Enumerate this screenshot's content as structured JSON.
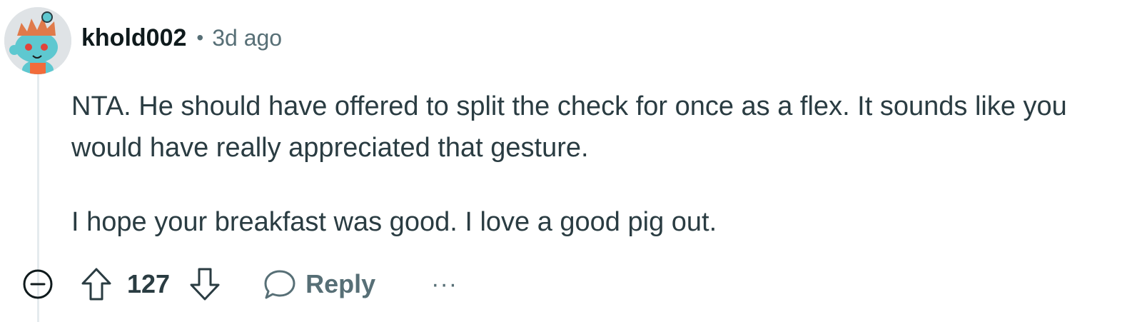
{
  "comment": {
    "username": "khold002",
    "separator": "•",
    "timestamp": "3d ago",
    "paragraphs": [
      "NTA. He should have offered to split the check for once as a flex. It sounds like you would have really appreciated that gesture.",
      "I hope your breakfast was good. I love a good pig out."
    ]
  },
  "actions": {
    "score": "127",
    "reply_label": "Reply",
    "more_label": "···"
  },
  "icons": {
    "avatar": "snoo-avatar-icon",
    "collapse": "collapse-minus-icon",
    "upvote": "upvote-arrow-icon",
    "downvote": "downvote-arrow-icon",
    "reply": "speech-bubble-icon",
    "more": "ellipsis-icon"
  },
  "colors": {
    "meta_gray": "#576f76",
    "body_text": "#2a3c42",
    "thread_line": "#e5ebee"
  }
}
